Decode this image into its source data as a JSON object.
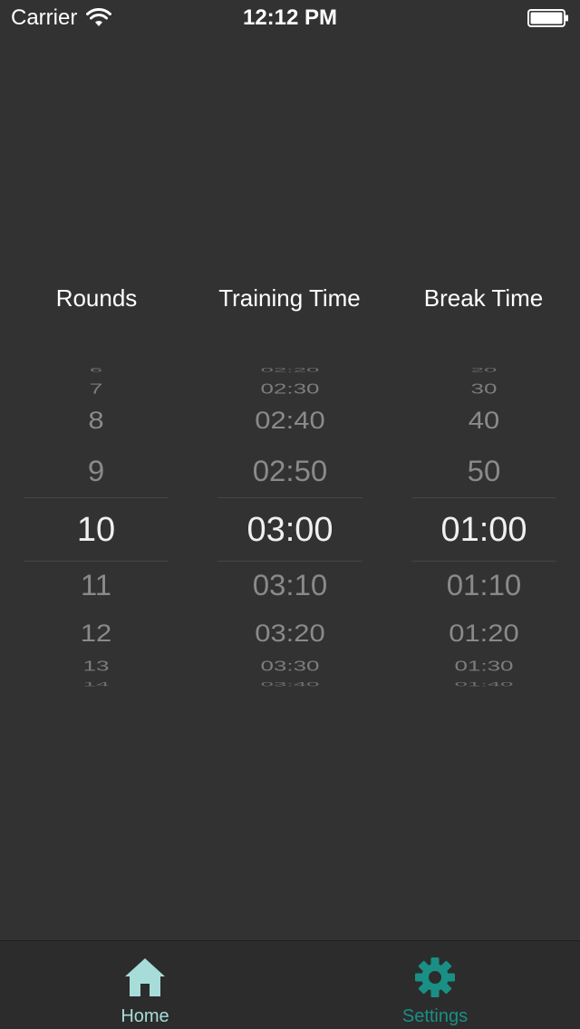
{
  "status_bar": {
    "carrier": "Carrier",
    "time": "12:12 PM"
  },
  "columns": [
    {
      "header": "Rounds",
      "items_above": [
        "6",
        "7",
        "8",
        "9"
      ],
      "selected": "10",
      "items_below": [
        "11",
        "12",
        "13",
        "14"
      ]
    },
    {
      "header": "Training Time",
      "items_above": [
        "02:20",
        "02:30",
        "02:40",
        "02:50"
      ],
      "selected": "03:00",
      "items_below": [
        "03:10",
        "03:20",
        "03:30",
        "03:40"
      ]
    },
    {
      "header": "Break Time",
      "items_above": [
        "20",
        "30",
        "40",
        "50"
      ],
      "selected": "01:00",
      "items_below": [
        "01:10",
        "01:20",
        "01:30",
        "01:40"
      ]
    }
  ],
  "tab_bar": {
    "tabs": [
      {
        "label": "Home",
        "icon": "home-icon",
        "color": "#a8dcd9"
      },
      {
        "label": "Settings",
        "icon": "gear-icon",
        "color": "#1a8f85"
      }
    ]
  },
  "colors": {
    "background": "#323232",
    "picker_text": "#8a8a8a",
    "picker_selected": "#f0f0f0",
    "home_tint": "#a8dcd9",
    "settings_tint": "#1a8f85"
  }
}
